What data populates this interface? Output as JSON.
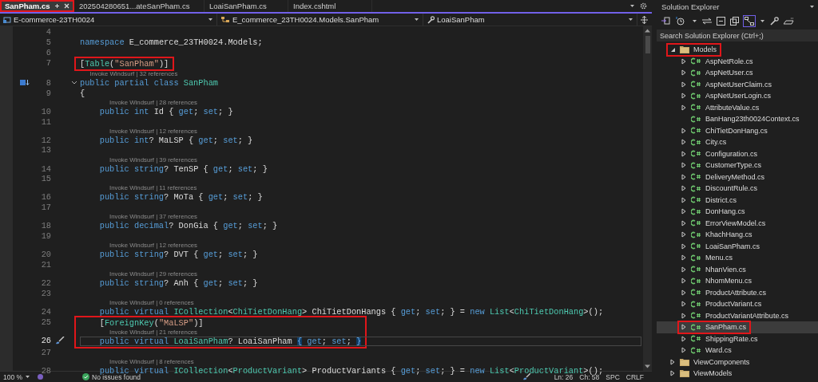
{
  "tabs": [
    {
      "label": "SanPham.cs",
      "selected": true,
      "annotated": true
    },
    {
      "label": "202504280651...ateSanPham.cs",
      "selected": false,
      "annotated": false
    },
    {
      "label": "LoaiSanPham.cs",
      "selected": false,
      "annotated": false
    },
    {
      "label": "Index.cshtml",
      "selected": false,
      "annotated": false
    }
  ],
  "navigation_bar": {
    "project": "E-commerce-23TH0024",
    "type": "E_commerce_23TH0024.Models.SanPham",
    "member": "LoaiSanPham"
  },
  "editor": {
    "lines": [
      {
        "kind": "line",
        "number": "4",
        "current": false
      },
      {
        "kind": "line",
        "number": "5",
        "current": false,
        "tokens": [
          {
            "kind": "keyword",
            "text": "namespace"
          },
          {
            "kind": "plain",
            "text": " E_commerce_23TH0024.Models;"
          }
        ]
      },
      {
        "kind": "line",
        "number": "6",
        "current": false
      },
      {
        "kind": "annotation",
        "lines": [
          {
            "kind": "line",
            "number": "7",
            "current": false,
            "tokens": [
              {
                "kind": "plain",
                "text": "["
              },
              {
                "kind": "type",
                "text": "Table"
              },
              {
                "kind": "plain",
                "text": "("
              },
              {
                "kind": "string",
                "text": "\"SanPham\""
              },
              {
                "kind": "plain",
                "text": ")]"
              }
            ]
          }
        ]
      },
      {
        "kind": "line",
        "number": "8",
        "current": false,
        "codelens": "Invoke Windsurf | 32 references",
        "foldable": true,
        "tokens": [
          {
            "kind": "keyword",
            "text": "public partial class "
          },
          {
            "kind": "type",
            "text": "SanPham"
          }
        ]
      },
      {
        "kind": "line",
        "number": "9",
        "current": false,
        "tokens": [
          {
            "kind": "plain",
            "text": "{"
          }
        ]
      },
      {
        "kind": "line",
        "number": "10",
        "current": false,
        "codelens": "Invoke Windsurf | 28 references",
        "tokens": [
          {
            "kind": "keyword",
            "text": "    public int"
          },
          {
            "kind": "plain",
            "text": " Id { "
          },
          {
            "kind": "keyword",
            "text": "get"
          },
          {
            "kind": "plain",
            "text": "; "
          },
          {
            "kind": "keyword",
            "text": "set"
          },
          {
            "kind": "plain",
            "text": "; }"
          }
        ]
      },
      {
        "kind": "line",
        "number": "11",
        "current": false
      },
      {
        "kind": "line",
        "number": "12",
        "current": false,
        "codelens": "Invoke Windsurf | 12 references",
        "tokens": [
          {
            "kind": "keyword",
            "text": "    public int"
          },
          {
            "kind": "plain",
            "text": "? MaLSP { "
          },
          {
            "kind": "keyword",
            "text": "get"
          },
          {
            "kind": "plain",
            "text": "; "
          },
          {
            "kind": "keyword",
            "text": "set"
          },
          {
            "kind": "plain",
            "text": "; }"
          }
        ]
      },
      {
        "kind": "line",
        "number": "13",
        "current": false
      },
      {
        "kind": "line",
        "number": "14",
        "current": false,
        "codelens": "Invoke Windsurf | 39 references",
        "tokens": [
          {
            "kind": "keyword",
            "text": "    public string"
          },
          {
            "kind": "plain",
            "text": "? TenSP { "
          },
          {
            "kind": "keyword",
            "text": "get"
          },
          {
            "kind": "plain",
            "text": "; "
          },
          {
            "kind": "keyword",
            "text": "set"
          },
          {
            "kind": "plain",
            "text": "; }"
          }
        ]
      },
      {
        "kind": "line",
        "number": "15",
        "current": false
      },
      {
        "kind": "line",
        "number": "16",
        "current": false,
        "codelens": "Invoke Windsurf | 11 references",
        "tokens": [
          {
            "kind": "keyword",
            "text": "    public string"
          },
          {
            "kind": "plain",
            "text": "? MoTa { "
          },
          {
            "kind": "keyword",
            "text": "get"
          },
          {
            "kind": "plain",
            "text": "; "
          },
          {
            "kind": "keyword",
            "text": "set"
          },
          {
            "kind": "plain",
            "text": "; }"
          }
        ]
      },
      {
        "kind": "line",
        "number": "17",
        "current": false
      },
      {
        "kind": "line",
        "number": "18",
        "current": false,
        "codelens": "Invoke Windsurf | 37 references",
        "tokens": [
          {
            "kind": "keyword",
            "text": "    public decimal"
          },
          {
            "kind": "plain",
            "text": "? DonGia { "
          },
          {
            "kind": "keyword",
            "text": "get"
          },
          {
            "kind": "plain",
            "text": "; "
          },
          {
            "kind": "keyword",
            "text": "set"
          },
          {
            "kind": "plain",
            "text": "; }"
          }
        ]
      },
      {
        "kind": "line",
        "number": "19",
        "current": false
      },
      {
        "kind": "line",
        "number": "20",
        "current": false,
        "codelens": "Invoke Windsurf | 12 references",
        "tokens": [
          {
            "kind": "keyword",
            "text": "    public string"
          },
          {
            "kind": "plain",
            "text": "? DVT { "
          },
          {
            "kind": "keyword",
            "text": "get"
          },
          {
            "kind": "plain",
            "text": "; "
          },
          {
            "kind": "keyword",
            "text": "set"
          },
          {
            "kind": "plain",
            "text": "; }"
          }
        ]
      },
      {
        "kind": "line",
        "number": "21",
        "current": false
      },
      {
        "kind": "line",
        "number": "22",
        "current": false,
        "codelens": "Invoke Windsurf | 29 references",
        "tokens": [
          {
            "kind": "keyword",
            "text": "    public string"
          },
          {
            "kind": "plain",
            "text": "? Anh { "
          },
          {
            "kind": "keyword",
            "text": "get"
          },
          {
            "kind": "plain",
            "text": "; "
          },
          {
            "kind": "keyword",
            "text": "set"
          },
          {
            "kind": "plain",
            "text": "; }"
          }
        ]
      },
      {
        "kind": "line",
        "number": "23",
        "current": false
      },
      {
        "kind": "line",
        "number": "24",
        "current": false,
        "codelens": "Invoke Windsurf | 0 references",
        "tokens": [
          {
            "kind": "keyword",
            "text": "    public virtual "
          },
          {
            "kind": "type",
            "text": "ICollection"
          },
          {
            "kind": "plain",
            "text": "<"
          },
          {
            "kind": "type",
            "text": "ChiTietDonHang"
          },
          {
            "kind": "plain",
            "text": "> ChiTietDonHangs { "
          },
          {
            "kind": "keyword",
            "text": "get"
          },
          {
            "kind": "plain",
            "text": "; "
          },
          {
            "kind": "keyword",
            "text": "set"
          },
          {
            "kind": "plain",
            "text": "; } = "
          },
          {
            "kind": "keyword",
            "text": "new "
          },
          {
            "kind": "type",
            "text": "List"
          },
          {
            "kind": "plain",
            "text": "<"
          },
          {
            "kind": "type",
            "text": "ChiTietDonHang"
          },
          {
            "kind": "plain",
            "text": ">();"
          }
        ]
      },
      {
        "kind": "annotation",
        "lines": [
          {
            "kind": "line",
            "number": "25",
            "current": false,
            "tokens": [
              {
                "kind": "plain",
                "text": "    ["
              },
              {
                "kind": "type",
                "text": "ForeignKey"
              },
              {
                "kind": "plain",
                "text": "("
              },
              {
                "kind": "string",
                "text": "\"MaLSP\""
              },
              {
                "kind": "plain",
                "text": ")]"
              }
            ]
          },
          {
            "kind": "line",
            "number": "26",
            "current": true,
            "codelens": "Invoke Windsurf | 21 references",
            "tokens": [
              {
                "kind": "keyword",
                "text": "    public virtual "
              },
              {
                "kind": "type",
                "text": "LoaiSanPham"
              },
              {
                "kind": "plain",
                "text": "? LoaiSanPham "
              },
              {
                "kind": "brace",
                "text": "{"
              },
              {
                "kind": "keyword",
                "text": " get"
              },
              {
                "kind": "plain",
                "text": "; "
              },
              {
                "kind": "keyword",
                "text": "set"
              },
              {
                "kind": "plain",
                "text": "; "
              },
              {
                "kind": "brace",
                "text": "}"
              }
            ]
          }
        ]
      },
      {
        "kind": "line",
        "number": "27",
        "current": false
      },
      {
        "kind": "line",
        "number": "28",
        "current": false,
        "codelens": "Invoke Windsurf | 8 references",
        "tokens": [
          {
            "kind": "keyword",
            "text": "    public virtual "
          },
          {
            "kind": "type",
            "text": "ICollection"
          },
          {
            "kind": "plain",
            "text": "<"
          },
          {
            "kind": "type",
            "text": "ProductVariant"
          },
          {
            "kind": "plain",
            "text": "> ProductVariants { "
          },
          {
            "kind": "keyword",
            "text": "get"
          },
          {
            "kind": "plain",
            "text": "; "
          },
          {
            "kind": "keyword",
            "text": "set"
          },
          {
            "kind": "plain",
            "text": "; } = "
          },
          {
            "kind": "keyword",
            "text": "new "
          },
          {
            "kind": "type",
            "text": "List"
          },
          {
            "kind": "plain",
            "text": "<"
          },
          {
            "kind": "type",
            "text": "ProductVariant"
          },
          {
            "kind": "plain",
            "text": ">();"
          }
        ]
      }
    ]
  },
  "status_bar": {
    "zoom": "100 %",
    "issues": "No issues found",
    "line": "Ln: 26",
    "column": "Ch: 58",
    "indentation": "SPC",
    "line_ending": "CRLF"
  },
  "solution_explorer": {
    "title": "Solution Explorer",
    "search": {
      "placeholder": "Search Solution Explorer (Ctrl+;)"
    },
    "tree": [
      {
        "label": "Models",
        "kind": "folder",
        "expandable": true,
        "expanded": true,
        "selected": false,
        "annotated": true,
        "children": [
          {
            "label": "AspNetRole.cs",
            "kind": "file",
            "expandable": true,
            "expanded": false,
            "selected": false,
            "annotated": false
          },
          {
            "label": "AspNetUser.cs",
            "kind": "file",
            "expandable": true,
            "expanded": false,
            "selected": false,
            "annotated": false
          },
          {
            "label": "AspNetUserClaim.cs",
            "kind": "file",
            "expandable": true,
            "expanded": false,
            "selected": false,
            "annotated": false
          },
          {
            "label": "AspNetUserLogin.cs",
            "kind": "file",
            "expandable": true,
            "expanded": false,
            "selected": false,
            "annotated": false
          },
          {
            "label": "AttributeValue.cs",
            "kind": "file",
            "expandable": true,
            "expanded": false,
            "selected": false,
            "annotated": false
          },
          {
            "label": "BanHang23th0024Context.cs",
            "kind": "file",
            "expandable": false,
            "expanded": false,
            "selected": false,
            "annotated": false
          },
          {
            "label": "ChiTietDonHang.cs",
            "kind": "file",
            "expandable": true,
            "expanded": false,
            "selected": false,
            "annotated": false
          },
          {
            "label": "City.cs",
            "kind": "file",
            "expandable": true,
            "expanded": false,
            "selected": false,
            "annotated": false
          },
          {
            "label": "Configuration.cs",
            "kind": "file",
            "expandable": true,
            "expanded": false,
            "selected": false,
            "annotated": false
          },
          {
            "label": "CustomerType.cs",
            "kind": "file",
            "expandable": true,
            "expanded": false,
            "selected": false,
            "annotated": false
          },
          {
            "label": "DeliveryMethod.cs",
            "kind": "file",
            "expandable": true,
            "expanded": false,
            "selected": false,
            "annotated": false
          },
          {
            "label": "DiscountRule.cs",
            "kind": "file",
            "expandable": true,
            "expanded": false,
            "selected": false,
            "annotated": false
          },
          {
            "label": "District.cs",
            "kind": "file",
            "expandable": true,
            "expanded": false,
            "selected": false,
            "annotated": false
          },
          {
            "label": "DonHang.cs",
            "kind": "file",
            "expandable": true,
            "expanded": false,
            "selected": false,
            "annotated": false
          },
          {
            "label": "ErrorViewModel.cs",
            "kind": "file",
            "expandable": true,
            "expanded": false,
            "selected": false,
            "annotated": false
          },
          {
            "label": "KhachHang.cs",
            "kind": "file",
            "expandable": true,
            "expanded": false,
            "selected": false,
            "annotated": false
          },
          {
            "label": "LoaiSanPham.cs",
            "kind": "file",
            "expandable": true,
            "expanded": false,
            "selected": false,
            "annotated": false
          },
          {
            "label": "Menu.cs",
            "kind": "file",
            "expandable": true,
            "expanded": false,
            "selected": false,
            "annotated": false
          },
          {
            "label": "NhanVien.cs",
            "kind": "file",
            "expandable": true,
            "expanded": false,
            "selected": false,
            "annotated": false
          },
          {
            "label": "NhomMenu.cs",
            "kind": "file",
            "expandable": true,
            "expanded": false,
            "selected": false,
            "annotated": false
          },
          {
            "label": "ProductAttribute.cs",
            "kind": "file",
            "expandable": true,
            "expanded": false,
            "selected": false,
            "annotated": false
          },
          {
            "label": "ProductVariant.cs",
            "kind": "file",
            "expandable": true,
            "expanded": false,
            "selected": false,
            "annotated": false
          },
          {
            "label": "ProductVariantAttribute.cs",
            "kind": "file",
            "expandable": true,
            "expanded": false,
            "selected": false,
            "annotated": false
          },
          {
            "label": "SanPham.cs",
            "kind": "file",
            "expandable": true,
            "expanded": false,
            "selected": true,
            "annotated": true
          },
          {
            "label": "ShippingRate.cs",
            "kind": "file",
            "expandable": true,
            "expanded": false,
            "selected": false,
            "annotated": false
          },
          {
            "label": "Ward.cs",
            "kind": "file",
            "expandable": true,
            "expanded": false,
            "selected": false,
            "annotated": false
          }
        ]
      },
      {
        "label": "ViewComponents",
        "kind": "folder",
        "expandable": true,
        "expanded": false,
        "selected": false,
        "annotated": false
      },
      {
        "label": "ViewModels",
        "kind": "folder",
        "expandable": true,
        "expanded": false,
        "selected": false,
        "annotated": false
      }
    ]
  }
}
